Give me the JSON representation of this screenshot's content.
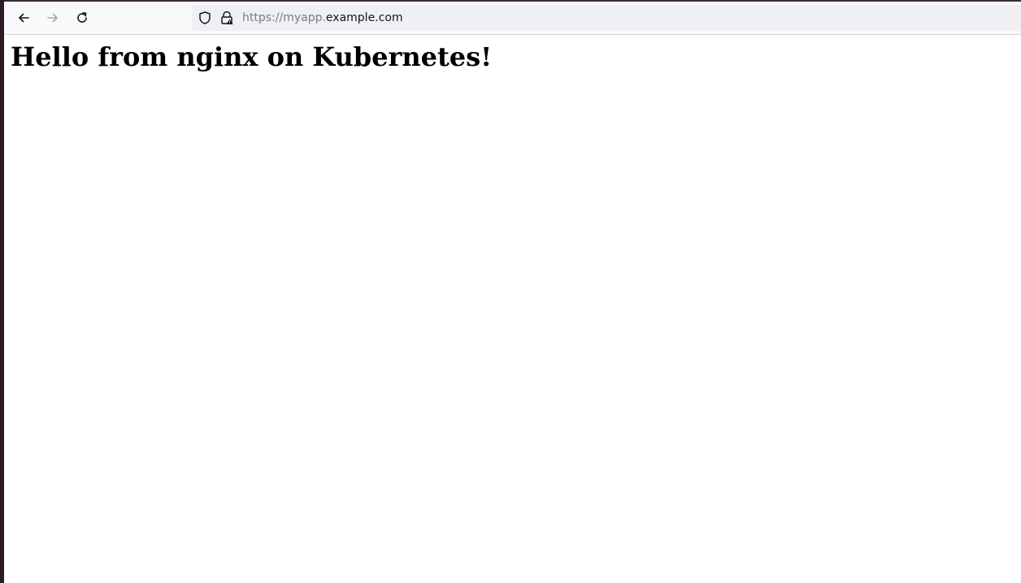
{
  "browser": {
    "toolbar": {
      "back_icon": "arrow-left-icon",
      "forward_icon": "arrow-right-icon",
      "reload_icon": "reload-icon",
      "forward_enabled": false
    },
    "urlbar": {
      "tracking_icon": "shield-icon",
      "security_icon": "lock-warning-icon",
      "url_scheme": "https://",
      "url_subdomain": "myapp.",
      "url_host": "example.com"
    }
  },
  "page": {
    "heading": "Hello from nginx on Kubernetes!"
  },
  "colors": {
    "toolbar_bg": "#f9f9fb",
    "urlbar_bg": "#f0f0f4",
    "url_muted": "#7a7a80",
    "url_host": "#15141a",
    "desktop_edge": "#2c1a26"
  }
}
